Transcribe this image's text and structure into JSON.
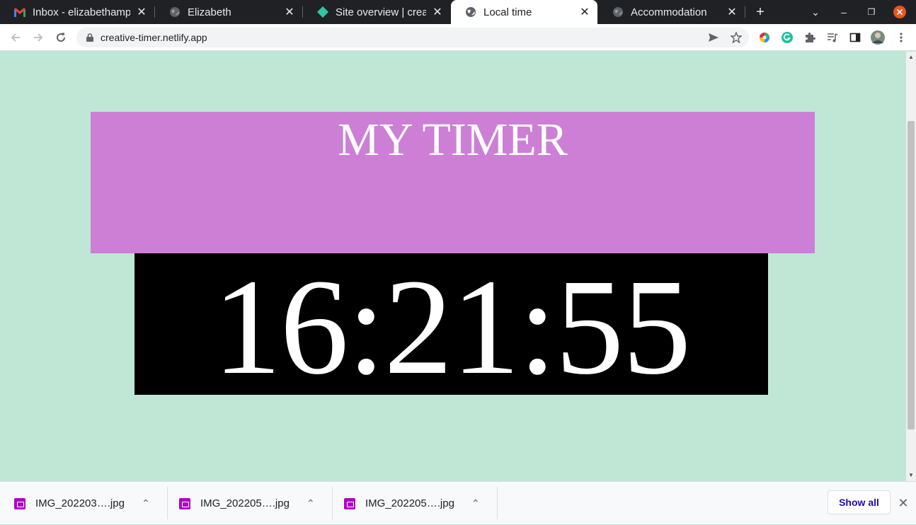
{
  "browser": {
    "tabs": [
      {
        "title": "Inbox - elizabethampu",
        "icon": "gmail-icon"
      },
      {
        "title": "Elizabeth",
        "icon": "globe-icon"
      },
      {
        "title": "Site overview | creativ",
        "icon": "netlify-icon"
      },
      {
        "title": "Local time",
        "icon": "globe-icon",
        "active": true
      },
      {
        "title": "Accommodation",
        "icon": "globe-icon"
      }
    ],
    "new_tab_symbol": "+",
    "url": "creative-timer.netlify.app"
  },
  "page": {
    "title": "MY TIMER",
    "time": "16:21:55",
    "colors": {
      "background": "#c0e6d6",
      "header": "#cd7fd5",
      "clock": "#000000"
    }
  },
  "downloads": {
    "items": [
      {
        "name": "IMG_202203….jpg"
      },
      {
        "name": "IMG_202205….jpg"
      },
      {
        "name": "IMG_202205….jpg"
      }
    ],
    "show_all_label": "Show all"
  }
}
